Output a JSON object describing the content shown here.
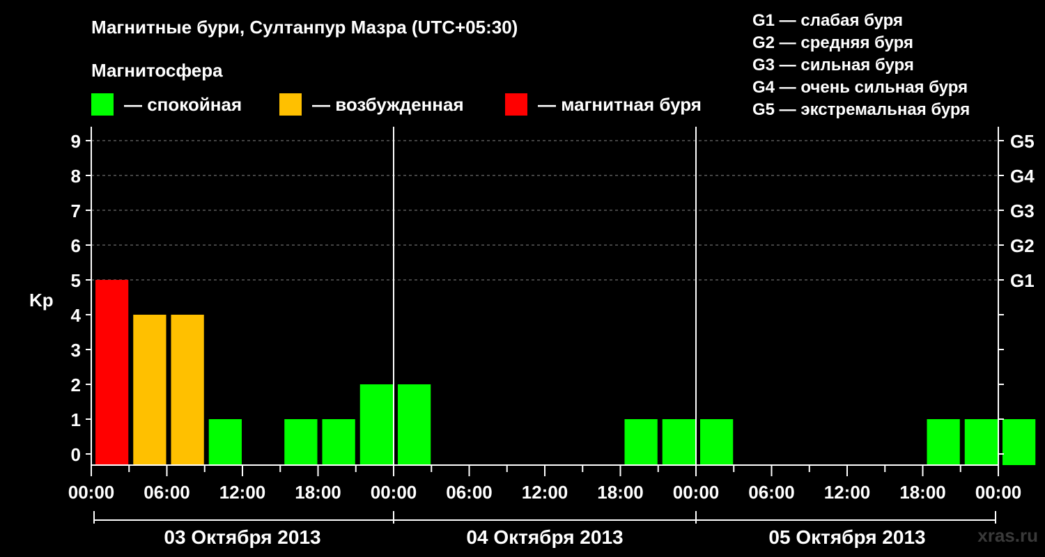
{
  "header": {
    "title": "Магнитные бури, Султанпур Мазра (UTC+05:30)",
    "legend_heading": "Магнитосфера"
  },
  "legend": [
    {
      "label": "— спокойная",
      "color": "#00ff00"
    },
    {
      "label": "— возбужденная",
      "color": "#ffc000"
    },
    {
      "label": "— магнитная буря",
      "color": "#ff0000"
    }
  ],
  "g_legend": [
    "G1 — слабая буря",
    "G2 — средняя буря",
    "G3 — сильная буря",
    "G4 — очень сильная буря",
    "G5 — экстремальная буря"
  ],
  "watermark": "xras.ru",
  "chart_data": {
    "type": "bar",
    "ylabel": "Kp",
    "ylim": [
      0,
      9
    ],
    "yticks": [
      0,
      1,
      2,
      3,
      4,
      5,
      6,
      7,
      8,
      9
    ],
    "right_axis": [
      {
        "kp": 5,
        "label": "G1"
      },
      {
        "kp": 6,
        "label": "G2"
      },
      {
        "kp": 7,
        "label": "G3"
      },
      {
        "kp": 8,
        "label": "G4"
      },
      {
        "kp": 9,
        "label": "G5"
      }
    ],
    "x_tick_labels": [
      "00:00",
      "06:00",
      "12:00",
      "18:00",
      "00:00",
      "06:00",
      "12:00",
      "18:00",
      "00:00",
      "06:00",
      "12:00",
      "18:00",
      "00:00"
    ],
    "days": [
      "03 Октября 2013",
      "04 Октября 2013",
      "05 Октября 2013"
    ],
    "bar_hours": 3,
    "grid": "dashed horizontal",
    "colors": {
      "quiet": "#00ff00",
      "active": "#ffc000",
      "storm": "#ff0000"
    },
    "values": [
      5,
      4,
      4,
      1,
      0,
      1,
      1,
      2,
      2,
      0,
      0,
      0,
      0,
      0,
      1,
      1,
      1,
      0,
      0,
      0,
      0,
      0,
      1,
      1,
      1,
      0
    ]
  }
}
